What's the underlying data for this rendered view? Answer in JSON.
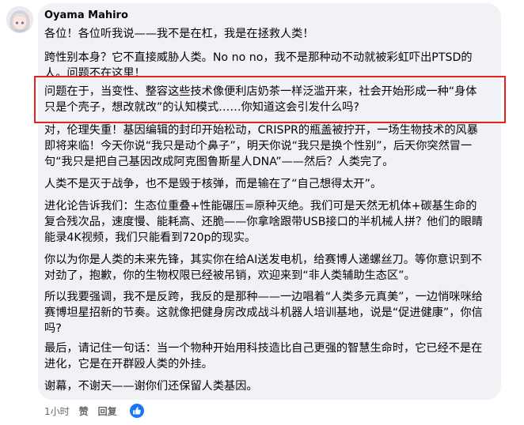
{
  "comment": {
    "author": "Oyama Mahiro",
    "paragraphs": [
      "各位！各位听我说——我不是在杠，我是在拯救人类！",
      "跨性别本身？它不直接威胁人类。No no no，我不是那种动不动就被彩虹吓出PTSD的人。问题不在这里！",
      "问题在于，当变性、整容这些技术像便利店奶茶一样泛滥开来，社会开始形成一种“身体只是个壳子，想改就改”的认知模式……你知道这会引发什么吗?",
      "对，伦理失重！基因编辑的封印开始松动，CRISPR的瓶盖被拧开，一场生物技术的风暴即将来临！今天你说“我只是动个鼻子”，明天你说“我只是换个性别”，后天你突然冒一句“我只是把自己基因改成阿克图鲁斯星人DNA”——然后？人类完了。",
      "人类不是灭于战争，也不是毁于核弹，而是输在了“自己想得太开”。",
      "进化论告诉我们：生态位重叠+性能碾压=原种灭绝。我们可是天然无机体+碳基生命的复合残次品，速度慢、能耗高、还脆——你拿啥跟带USB接口的半机械人拼？他们的眼睛能录4K视频，我们只能看到720p的现实。",
      "你以为你是人类的未来先锋，其实你在给AI送发电机，给赛博人递螺丝刀。等你意识到不对劲了，抱歉，你的生物权限已经被吊销，欢迎来到“非人类辅助生态区”。",
      "所以我要强调，我不是反跨，我反的是那种——一边唱着“人类多元真美”，一边悄咪咪给赛博坦星招新的节奏。这就像把健身房改成战斗机器人培训基地，说是“促进健康”，你信吗?",
      "最后，请记住一句话：当一个物种开始用科技造比自己更强的智慧生命时，它已经不是在进化，它是在开群殴人类的外挂。",
      "谢幕，不谢天——谢你们还保留人类基因。"
    ]
  },
  "actions": {
    "time": "1小时",
    "like_label": "赞",
    "reply_label": "回复"
  },
  "colors": {
    "highlight_border": "#e5221d",
    "bubble_bg": "#f0f2f5",
    "like_blue": "#1877f2"
  },
  "icons": {
    "reaction": "thumbs-up-icon",
    "avatar": "anime-avatar"
  }
}
